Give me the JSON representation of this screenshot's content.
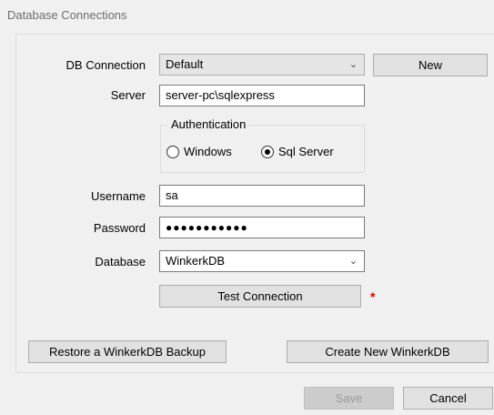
{
  "window": {
    "title": "Database Connections"
  },
  "form": {
    "db_connection_label": "DB Connection",
    "db_connection_value": "Default",
    "new_button": "New",
    "server_label": "Server",
    "server_value": "server-pc\\sqlexpress",
    "auth_group_title": "Authentication",
    "auth_options": [
      {
        "label": "Windows",
        "selected": false
      },
      {
        "label": "Sql Server",
        "selected": true
      }
    ],
    "username_label": "Username",
    "username_value": "sa",
    "password_label": "Password",
    "password_value": "●●●●●●●●●●●",
    "database_label": "Database",
    "database_value": "WinkerkDB",
    "test_connection_button": "Test Connection",
    "required_marker": "*"
  },
  "actions": {
    "restore_backup_button": "Restore a WinkerkDB Backup",
    "create_new_button": "Create New WinkerkDB",
    "save_button": "Save",
    "cancel_button": "Cancel"
  },
  "icons": {
    "dropdown": "chevron-down-icon"
  },
  "colors": {
    "required": "#e00000",
    "background": "#f0f0f0"
  }
}
